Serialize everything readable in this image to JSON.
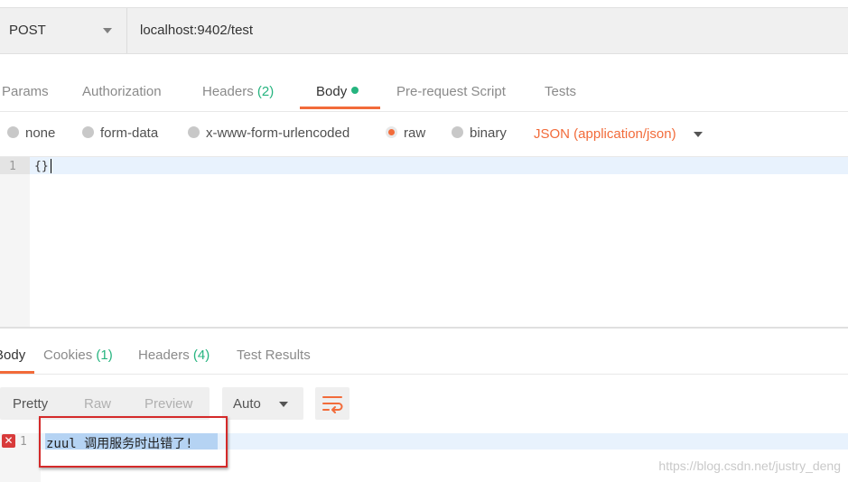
{
  "request": {
    "method": "POST",
    "url": "localhost:9402/test"
  },
  "request_tabs": [
    {
      "label": "Params"
    },
    {
      "label": "Authorization"
    },
    {
      "label": "Headers",
      "count": "(2)"
    },
    {
      "label": "Body",
      "active": true
    },
    {
      "label": "Pre-request Script"
    },
    {
      "label": "Tests"
    }
  ],
  "body_types": {
    "none": "none",
    "form_data": "form-data",
    "urlencoded": "x-www-form-urlencoded",
    "raw": "raw",
    "binary": "binary",
    "selected": "raw",
    "content_type": "JSON (application/json)"
  },
  "editor": {
    "line_number": "1",
    "code": "{}"
  },
  "response_tabs": [
    {
      "label": "Body",
      "active": true
    },
    {
      "label": "Cookies",
      "count": "(1)"
    },
    {
      "label": "Headers",
      "count": "(4)"
    },
    {
      "label": "Test Results"
    }
  ],
  "view_modes": {
    "pretty": "Pretty",
    "raw": "Raw",
    "preview": "Preview",
    "format": "Auto"
  },
  "response": {
    "line_number": "1",
    "error_icon": "✕",
    "text": "zuul 调用服务时出错了!"
  },
  "watermark": "https://blog.csdn.net/justry_deng",
  "colors": {
    "accent": "#f26b3a",
    "count_green": "#26b47f",
    "error_red": "#d83b3b"
  }
}
